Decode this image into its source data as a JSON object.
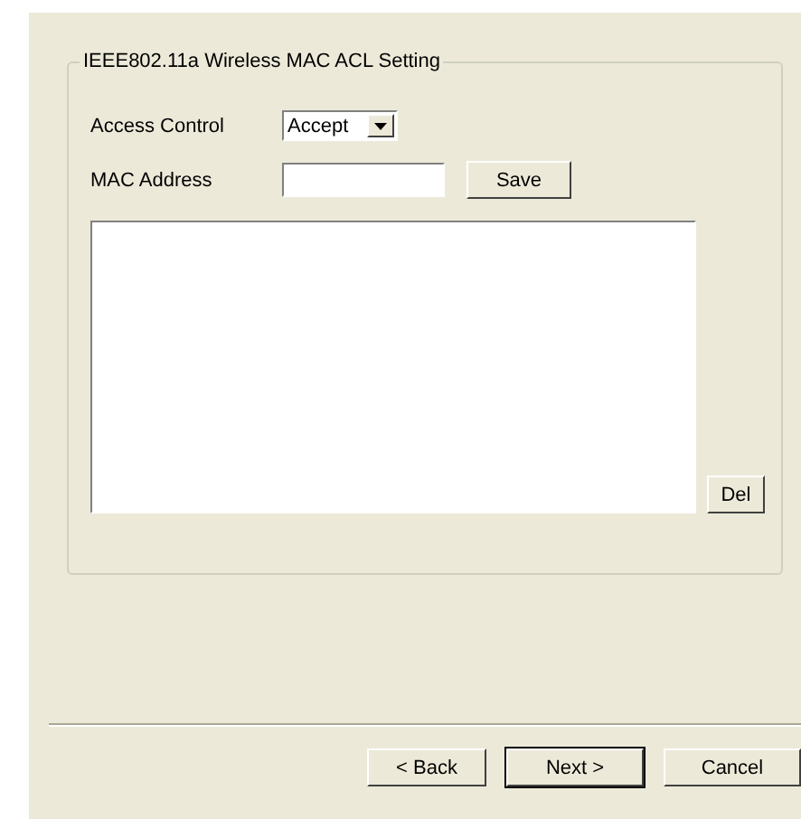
{
  "group": {
    "title": "IEEE802.11a Wireless MAC ACL Setting"
  },
  "access_control": {
    "label": "Access Control",
    "value": "Accept"
  },
  "mac_address": {
    "label": "MAC Address"
  },
  "save_button": "Save",
  "del_button": "Del",
  "buttons": [
    {
      "label": "< Back",
      "default": false
    },
    {
      "label": "Next >",
      "default": true
    },
    {
      "label": "Cancel",
      "default": false
    }
  ]
}
